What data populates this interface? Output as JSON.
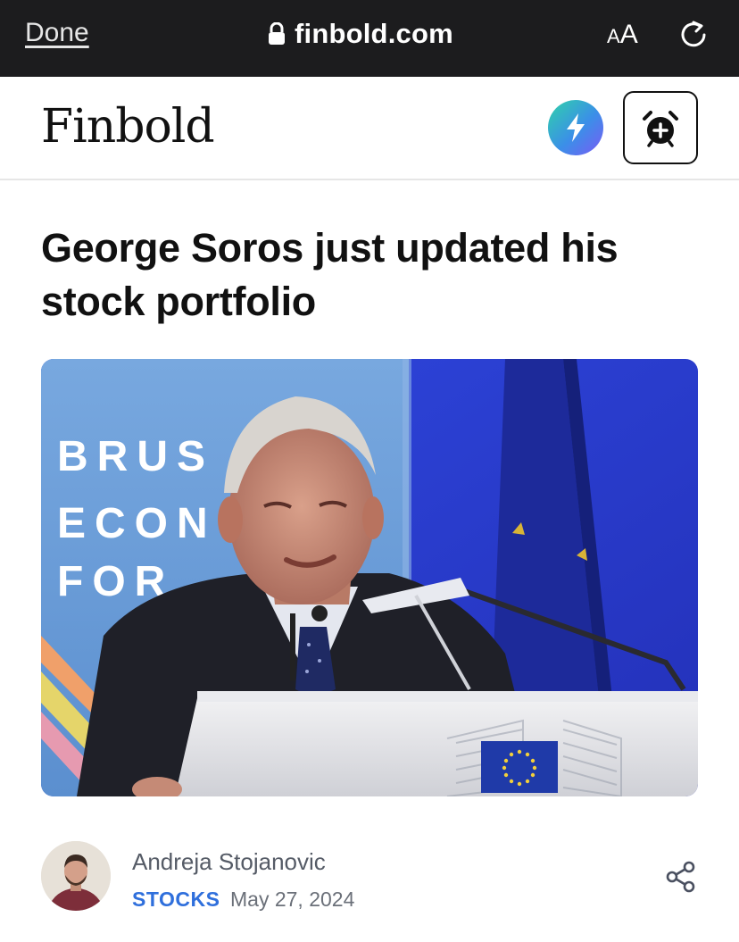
{
  "browser": {
    "done_label": "Done",
    "url": "finbold.com",
    "text_size_small": "A",
    "text_size_big": "A"
  },
  "site": {
    "logo_text": "Finbold",
    "flash_icon": "lightning-icon",
    "alarm_icon": "alarm-clock-plus-icon"
  },
  "article": {
    "headline_line1": "George Soros just updated his",
    "headline_line2": "stock portfolio",
    "hero_backdrop_text": [
      "BRUS",
      "ECON",
      "FOR"
    ],
    "author": "Andreja Stojanovic",
    "category": "STOCKS",
    "date": "May 27, 2024"
  },
  "colors": {
    "topbar": "#1c1c1e",
    "category": "#2f6fdc",
    "backdrop_blue": "#2a3fd6"
  }
}
